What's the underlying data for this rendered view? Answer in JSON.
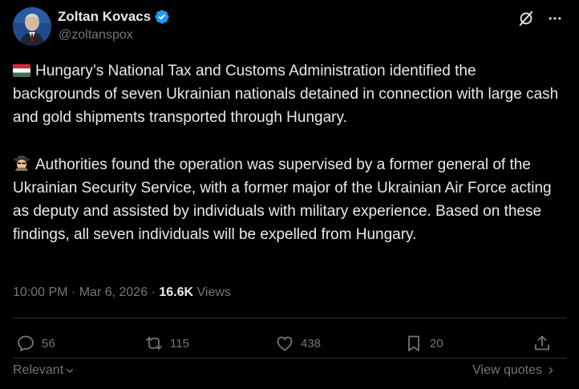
{
  "author": {
    "display_name": "Zoltan Kovacs",
    "handle": "@zoltanspox",
    "verified": true
  },
  "header_icons": [
    "grok-icon",
    "more-icon"
  ],
  "tweet": {
    "paragraph1_emoji": "hungary-flag",
    "paragraph1": "Hungary’s National Tax and Customs Administration identified the backgrounds of seven Ukrainian nationals detained in connection with large cash and gold shipments transported through Hungary.",
    "paragraph2_emoji": "detective-emoji",
    "paragraph2": "Authorities found the operation was supervised by a former general of the Ukrainian Security Service, with a former major of the Ukrainian Air Force acting as deputy and assisted by individuals with military experience. Based on these findings, all seven individuals will be expelled from Hungary."
  },
  "meta": {
    "time": "10:00 PM",
    "separator": "·",
    "date": "Mar 6, 2026",
    "views_count": "16.6K",
    "views_label": "Views"
  },
  "actions": {
    "replies": "56",
    "reposts": "115",
    "likes": "438",
    "bookmarks": "20"
  },
  "footer": {
    "relevant_label": "Relevant",
    "view_quotes_label": "View quotes"
  },
  "colors": {
    "background": "#000000",
    "text_primary": "#e7e9ea",
    "text_secondary": "#71767b",
    "divider": "#2f3336",
    "verified_blue": "#1d9bf0"
  }
}
